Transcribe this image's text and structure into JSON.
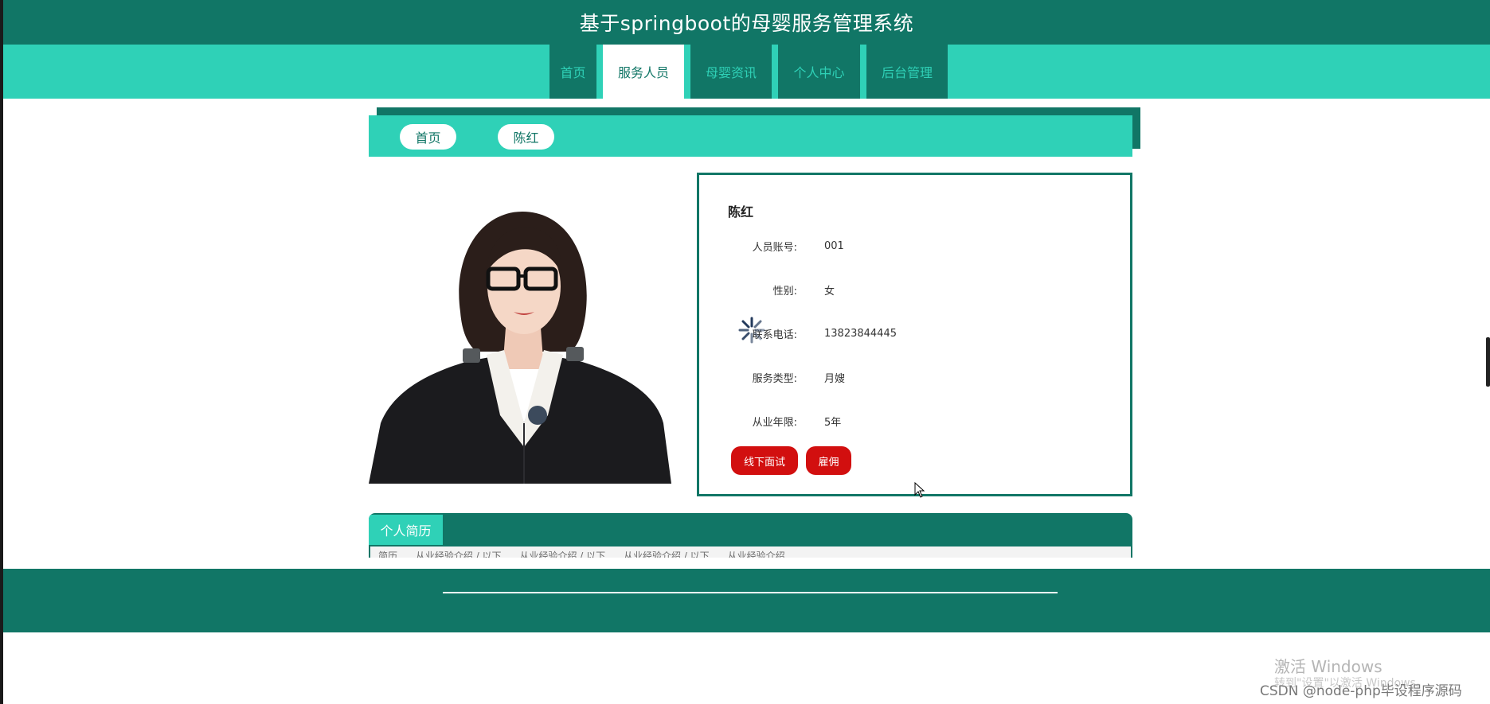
{
  "header": {
    "title": "基于springboot的母婴服务管理系统"
  },
  "nav": {
    "items": [
      {
        "label": "首页"
      },
      {
        "label": "服务人员"
      },
      {
        "label": "母婴资讯"
      },
      {
        "label": "个人中心"
      },
      {
        "label": "后台管理"
      }
    ],
    "active": "服务人员"
  },
  "breadcrumb": {
    "home": "首页",
    "current": "陈红"
  },
  "profile": {
    "name": "陈红",
    "fields": [
      {
        "label": "人员账号:",
        "value": "001"
      },
      {
        "label": "性别:",
        "value": "女"
      },
      {
        "label": "联系电话:",
        "value": "13823844445"
      },
      {
        "label": "服务类型:",
        "value": "月嫂"
      },
      {
        "label": "从业年限:",
        "value": "5年"
      }
    ],
    "buttons": {
      "interview": "线下面试",
      "hire": "雇佣"
    }
  },
  "resume": {
    "tab_label": "个人简历",
    "snippet": "简历......从业经验介绍 / 以下......从业经验介绍 / 以下......从业经验介绍 / 以下......从业经验介绍"
  },
  "watermark": {
    "line1": "激活 Windows",
    "line2": "转到\"设置\"以激活 Windows。"
  },
  "credit": "CSDN @node-php毕设程序源码",
  "colors": {
    "primary": "#117666",
    "accent": "#2fd1b7",
    "danger": "#d20f0f"
  },
  "icons": {
    "loading": "spinner-icon",
    "pointer": "mouse-cursor-icon"
  }
}
